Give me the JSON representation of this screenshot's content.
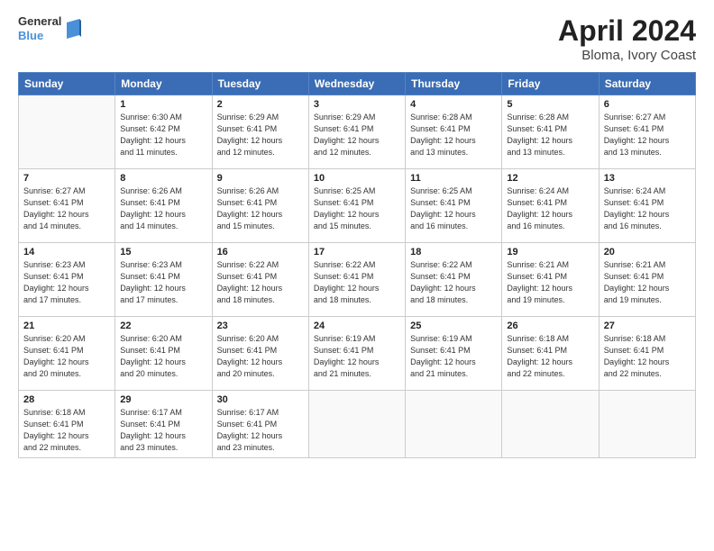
{
  "logo": {
    "line1": "General",
    "line2": "Blue"
  },
  "title": "April 2024",
  "subtitle": "Bloma, Ivory Coast",
  "weekdays": [
    "Sunday",
    "Monday",
    "Tuesday",
    "Wednesday",
    "Thursday",
    "Friday",
    "Saturday"
  ],
  "weeks": [
    [
      {
        "day": "",
        "info": ""
      },
      {
        "day": "1",
        "info": "Sunrise: 6:30 AM\nSunset: 6:42 PM\nDaylight: 12 hours\nand 11 minutes."
      },
      {
        "day": "2",
        "info": "Sunrise: 6:29 AM\nSunset: 6:41 PM\nDaylight: 12 hours\nand 12 minutes."
      },
      {
        "day": "3",
        "info": "Sunrise: 6:29 AM\nSunset: 6:41 PM\nDaylight: 12 hours\nand 12 minutes."
      },
      {
        "day": "4",
        "info": "Sunrise: 6:28 AM\nSunset: 6:41 PM\nDaylight: 12 hours\nand 13 minutes."
      },
      {
        "day": "5",
        "info": "Sunrise: 6:28 AM\nSunset: 6:41 PM\nDaylight: 12 hours\nand 13 minutes."
      },
      {
        "day": "6",
        "info": "Sunrise: 6:27 AM\nSunset: 6:41 PM\nDaylight: 12 hours\nand 13 minutes."
      }
    ],
    [
      {
        "day": "7",
        "info": "Sunrise: 6:27 AM\nSunset: 6:41 PM\nDaylight: 12 hours\nand 14 minutes."
      },
      {
        "day": "8",
        "info": "Sunrise: 6:26 AM\nSunset: 6:41 PM\nDaylight: 12 hours\nand 14 minutes."
      },
      {
        "day": "9",
        "info": "Sunrise: 6:26 AM\nSunset: 6:41 PM\nDaylight: 12 hours\nand 15 minutes."
      },
      {
        "day": "10",
        "info": "Sunrise: 6:25 AM\nSunset: 6:41 PM\nDaylight: 12 hours\nand 15 minutes."
      },
      {
        "day": "11",
        "info": "Sunrise: 6:25 AM\nSunset: 6:41 PM\nDaylight: 12 hours\nand 16 minutes."
      },
      {
        "day": "12",
        "info": "Sunrise: 6:24 AM\nSunset: 6:41 PM\nDaylight: 12 hours\nand 16 minutes."
      },
      {
        "day": "13",
        "info": "Sunrise: 6:24 AM\nSunset: 6:41 PM\nDaylight: 12 hours\nand 16 minutes."
      }
    ],
    [
      {
        "day": "14",
        "info": "Sunrise: 6:23 AM\nSunset: 6:41 PM\nDaylight: 12 hours\nand 17 minutes."
      },
      {
        "day": "15",
        "info": "Sunrise: 6:23 AM\nSunset: 6:41 PM\nDaylight: 12 hours\nand 17 minutes."
      },
      {
        "day": "16",
        "info": "Sunrise: 6:22 AM\nSunset: 6:41 PM\nDaylight: 12 hours\nand 18 minutes."
      },
      {
        "day": "17",
        "info": "Sunrise: 6:22 AM\nSunset: 6:41 PM\nDaylight: 12 hours\nand 18 minutes."
      },
      {
        "day": "18",
        "info": "Sunrise: 6:22 AM\nSunset: 6:41 PM\nDaylight: 12 hours\nand 18 minutes."
      },
      {
        "day": "19",
        "info": "Sunrise: 6:21 AM\nSunset: 6:41 PM\nDaylight: 12 hours\nand 19 minutes."
      },
      {
        "day": "20",
        "info": "Sunrise: 6:21 AM\nSunset: 6:41 PM\nDaylight: 12 hours\nand 19 minutes."
      }
    ],
    [
      {
        "day": "21",
        "info": "Sunrise: 6:20 AM\nSunset: 6:41 PM\nDaylight: 12 hours\nand 20 minutes."
      },
      {
        "day": "22",
        "info": "Sunrise: 6:20 AM\nSunset: 6:41 PM\nDaylight: 12 hours\nand 20 minutes."
      },
      {
        "day": "23",
        "info": "Sunrise: 6:20 AM\nSunset: 6:41 PM\nDaylight: 12 hours\nand 20 minutes."
      },
      {
        "day": "24",
        "info": "Sunrise: 6:19 AM\nSunset: 6:41 PM\nDaylight: 12 hours\nand 21 minutes."
      },
      {
        "day": "25",
        "info": "Sunrise: 6:19 AM\nSunset: 6:41 PM\nDaylight: 12 hours\nand 21 minutes."
      },
      {
        "day": "26",
        "info": "Sunrise: 6:18 AM\nSunset: 6:41 PM\nDaylight: 12 hours\nand 22 minutes."
      },
      {
        "day": "27",
        "info": "Sunrise: 6:18 AM\nSunset: 6:41 PM\nDaylight: 12 hours\nand 22 minutes."
      }
    ],
    [
      {
        "day": "28",
        "info": "Sunrise: 6:18 AM\nSunset: 6:41 PM\nDaylight: 12 hours\nand 22 minutes."
      },
      {
        "day": "29",
        "info": "Sunrise: 6:17 AM\nSunset: 6:41 PM\nDaylight: 12 hours\nand 23 minutes."
      },
      {
        "day": "30",
        "info": "Sunrise: 6:17 AM\nSunset: 6:41 PM\nDaylight: 12 hours\nand 23 minutes."
      },
      {
        "day": "",
        "info": ""
      },
      {
        "day": "",
        "info": ""
      },
      {
        "day": "",
        "info": ""
      },
      {
        "day": "",
        "info": ""
      }
    ]
  ]
}
